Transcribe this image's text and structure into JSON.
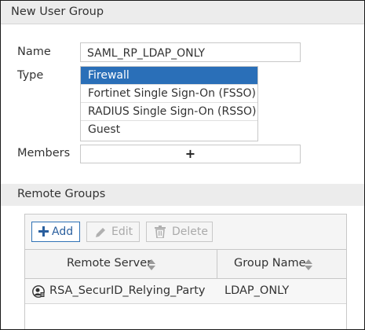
{
  "dialog": {
    "title": "New User Group"
  },
  "form": {
    "name_label": "Name",
    "name_value": "SAML_RP_LDAP_ONLY",
    "type_label": "Type",
    "type_options": [
      "Firewall",
      "Fortinet Single Sign-On (FSSO)",
      "RADIUS Single Sign-On (RSSO)",
      "Guest"
    ],
    "type_selected": "Firewall",
    "members_label": "Members",
    "members_add_symbol": "+"
  },
  "remote_groups": {
    "section_title": "Remote Groups",
    "toolbar": {
      "add_label": "Add",
      "edit_label": "Edit",
      "delete_label": "Delete"
    },
    "columns": [
      "Remote Server",
      "Group Name"
    ],
    "rows": [
      {
        "remote_server": "RSA_SecurID_Relying_Party",
        "group_name": "LDAP_ONLY"
      }
    ]
  },
  "colors": {
    "accent": "#2a6fb8",
    "selected_text": "#ffffff",
    "header_bg": "#ececec"
  },
  "icons": [
    "plus-icon",
    "pencil-icon",
    "trash-icon",
    "sort-icon",
    "user-server-icon"
  ]
}
